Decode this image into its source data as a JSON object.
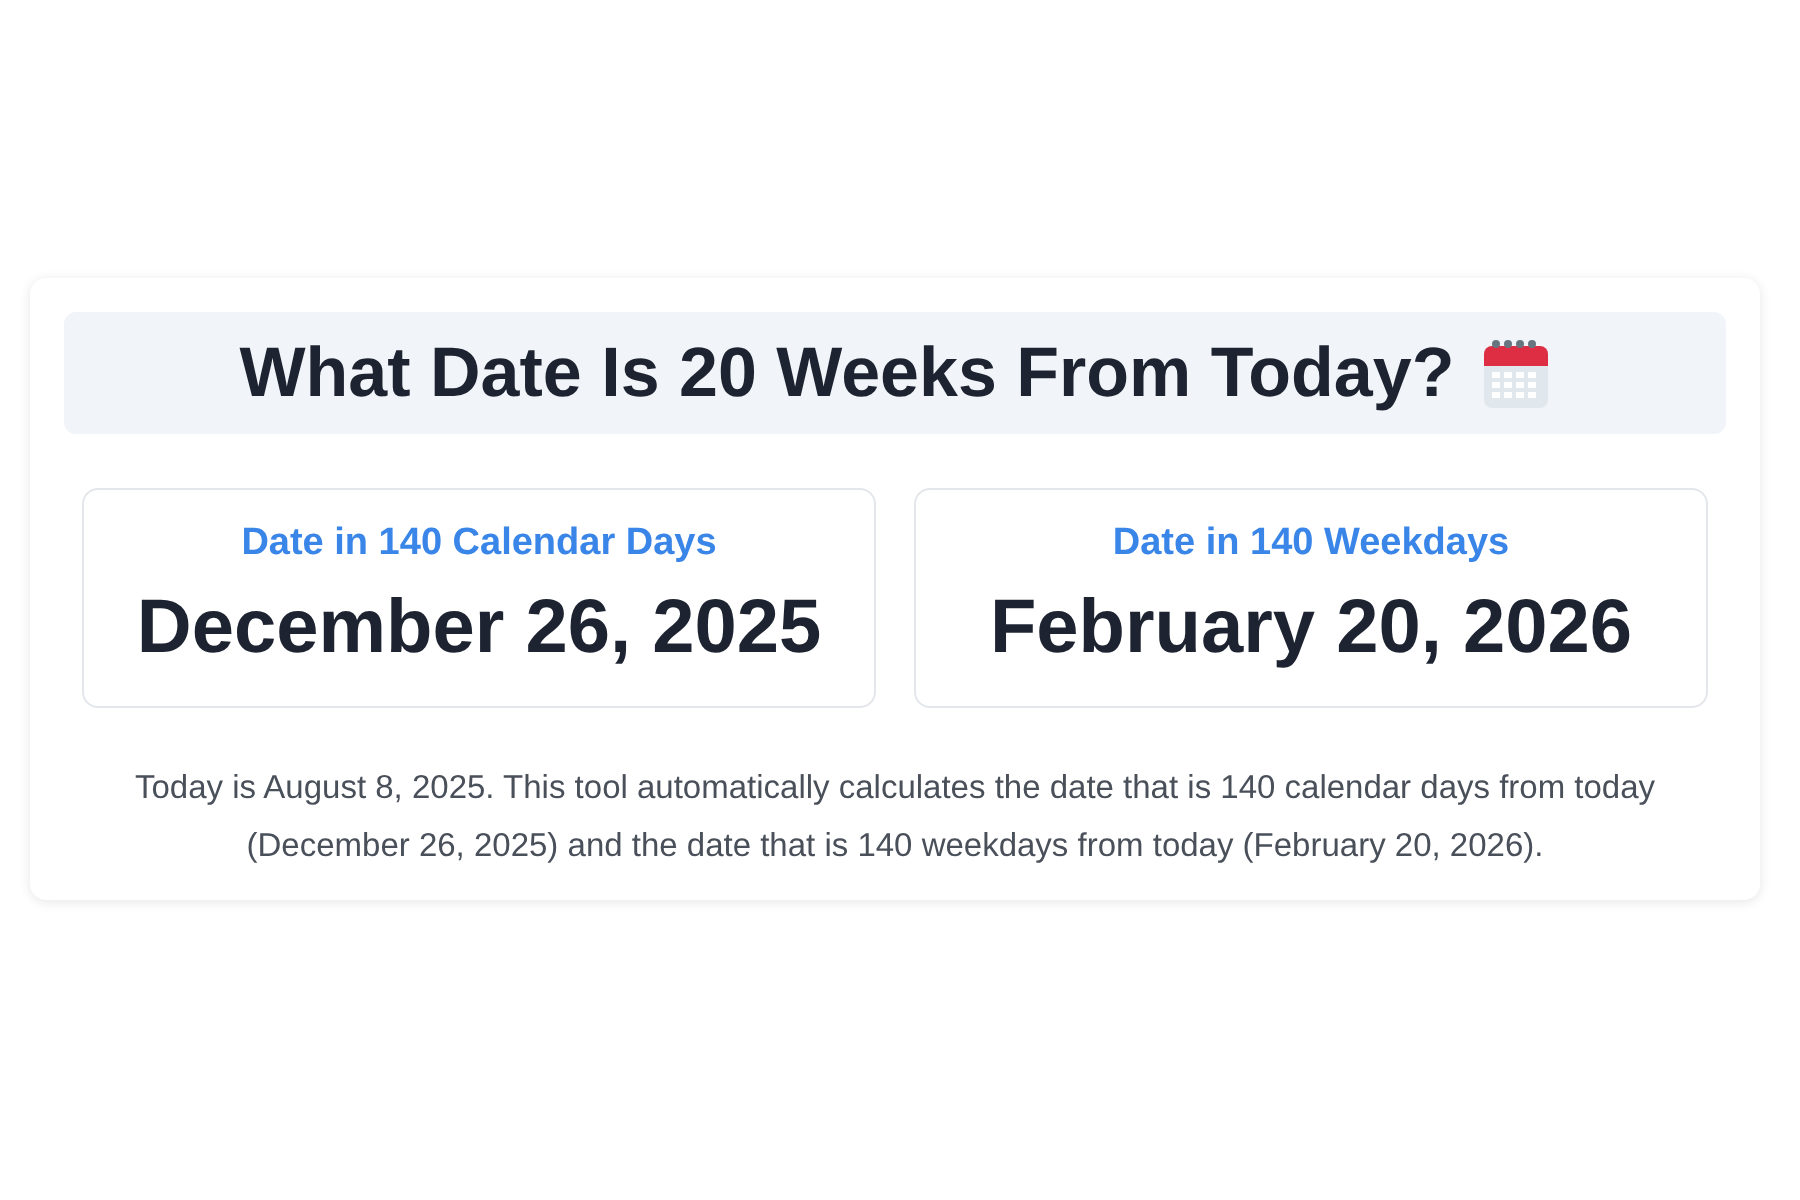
{
  "title": "What Date Is 20 Weeks From Today?",
  "results": [
    {
      "label": "Date in 140 Calendar Days",
      "date": "December 26, 2025"
    },
    {
      "label": "Date in 140 Weekdays",
      "date": "February 20, 2026"
    }
  ],
  "description": "Today is August 8, 2025. This tool automatically calculates the date that is 140 calendar days from today (December 26, 2025) and the date that is 140 weekdays from today (February 20, 2026)."
}
